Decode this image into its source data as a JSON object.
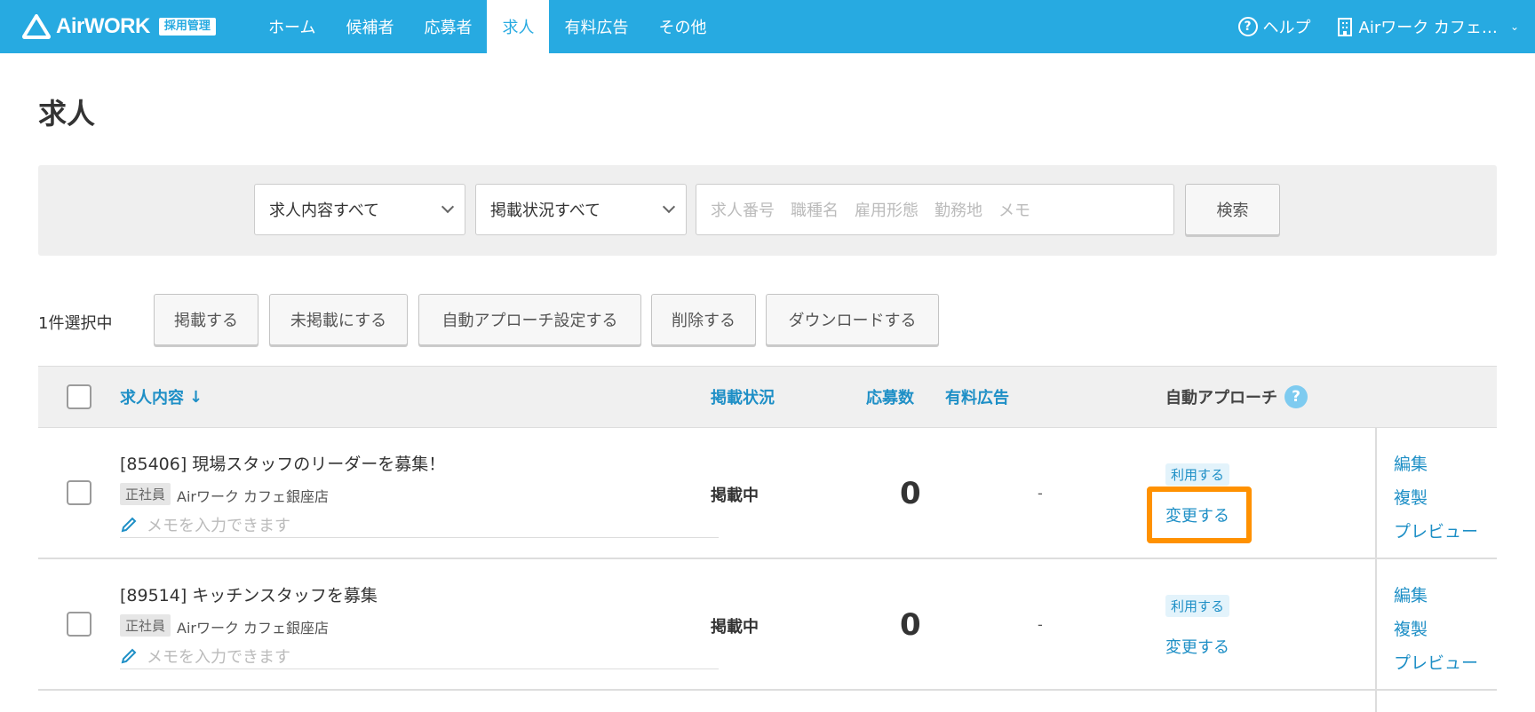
{
  "header": {
    "logo_text": "AirWORK",
    "logo_badge": "採用管理",
    "nav": [
      {
        "label": "ホーム",
        "active": false
      },
      {
        "label": "候補者",
        "active": false
      },
      {
        "label": "応募者",
        "active": false
      },
      {
        "label": "求人",
        "active": true
      },
      {
        "label": "有料広告",
        "active": false
      },
      {
        "label": "その他",
        "active": false
      }
    ],
    "help_label": "ヘルプ",
    "store_label": "Airワーク カフェ…"
  },
  "page": {
    "title": "求人"
  },
  "search": {
    "content_select": "求人内容すべて",
    "status_select": "掲載状況すべて",
    "keyword_placeholder": "求人番号　職種名　雇用形態　勤務地　メモ",
    "search_button": "検索"
  },
  "actions": {
    "selected_count": "1件選択中",
    "buttons": [
      "掲載する",
      "未掲載にする",
      "自動アプローチ設定する",
      "削除する",
      "ダウンロードする"
    ]
  },
  "table": {
    "headers": {
      "content": "求人内容",
      "status": "掲載状況",
      "applicants": "応募数",
      "paid_ad": "有料広告",
      "auto_approach": "自動アプローチ"
    },
    "rows": [
      {
        "title": "[85406] 現場スタッフのリーダーを募集！",
        "employment": "正社員",
        "shop": "Airワーク カフェ銀座店",
        "memo_placeholder": "メモを入力できます",
        "status": "掲載中",
        "applicants": "0",
        "paid_ad": "-",
        "auto_badge": "利用する",
        "auto_change": "変更する",
        "ops": [
          "編集",
          "複製",
          "プレビュー"
        ]
      },
      {
        "title": "[89514] キッチンスタッフを募集",
        "employment": "正社員",
        "shop": "Airワーク カフェ銀座店",
        "memo_placeholder": "メモを入力できます",
        "status": "掲載中",
        "applicants": "0",
        "paid_ad": "-",
        "auto_badge": "利用する",
        "auto_change": "変更する",
        "ops": [
          "編集",
          "複製",
          "プレビュー"
        ]
      }
    ]
  },
  "colors": {
    "brand": "#27aae1",
    "link": "#1e8fc6",
    "highlight": "#ff9100"
  }
}
